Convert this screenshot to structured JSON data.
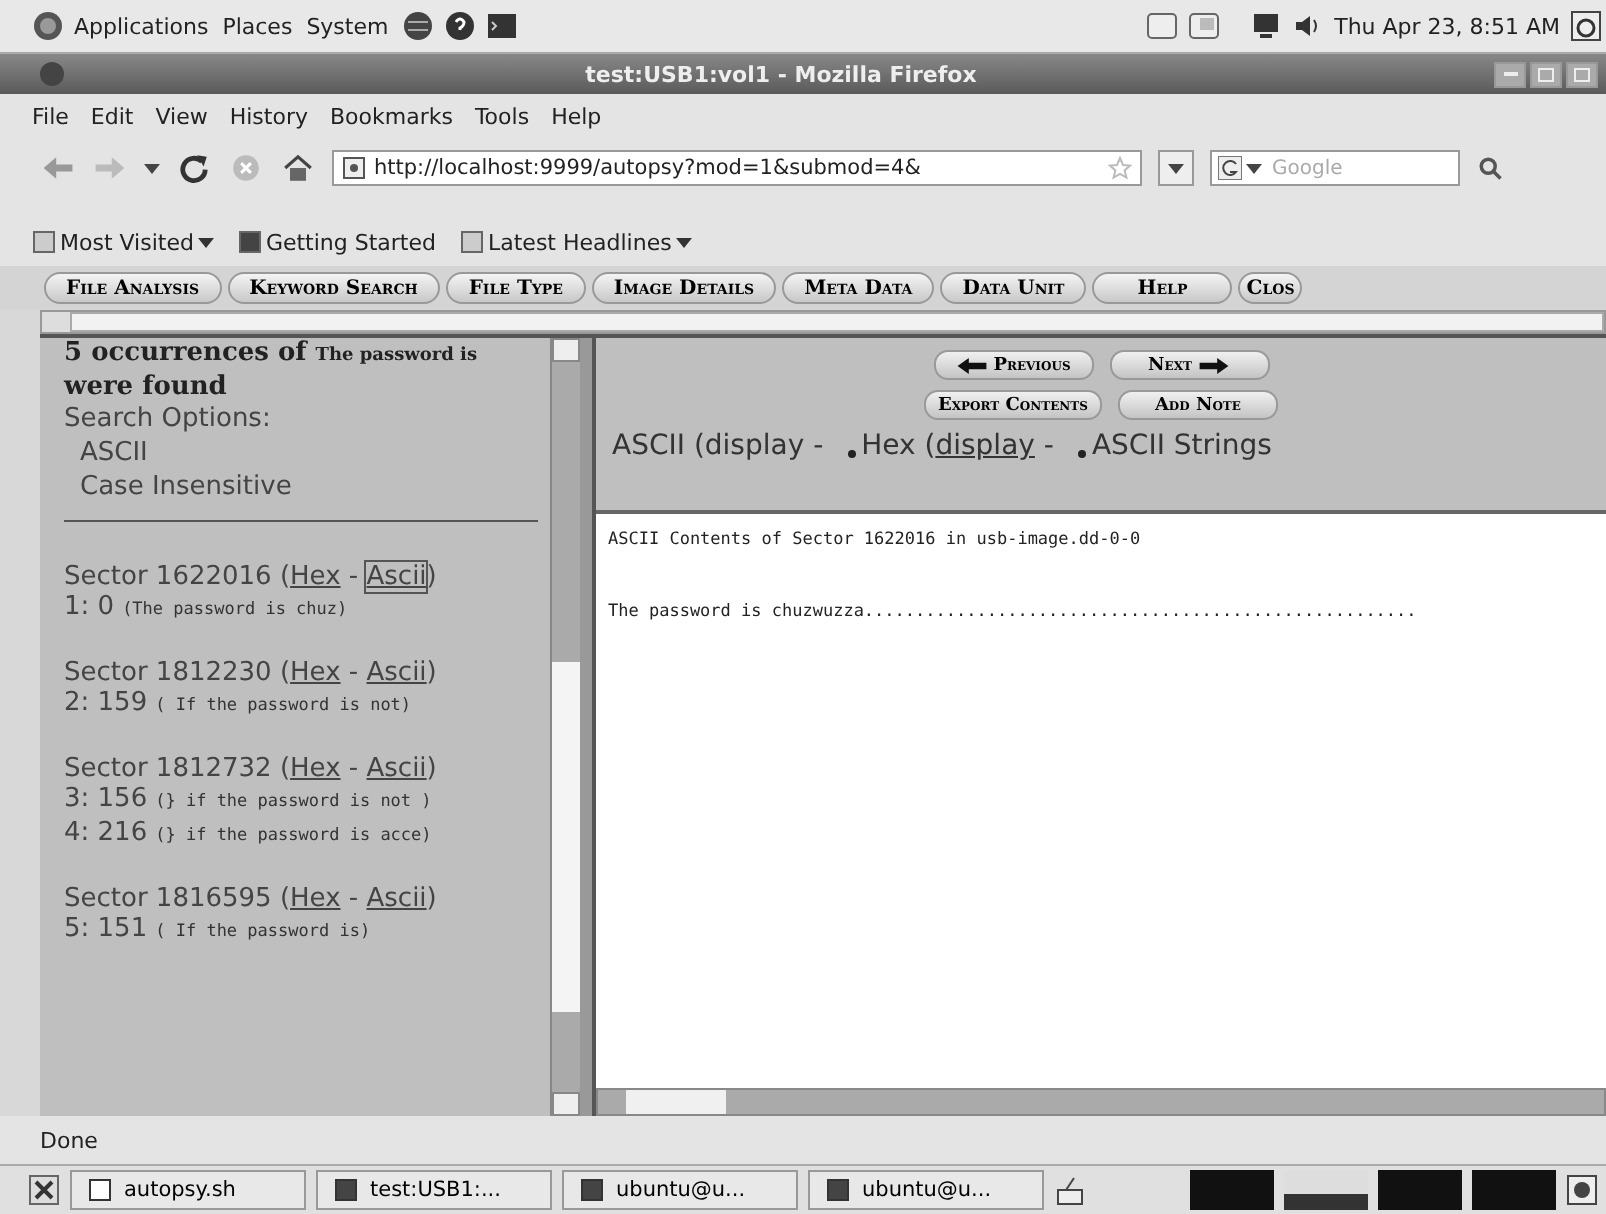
{
  "panel": {
    "menus": [
      "Applications",
      "Places",
      "System"
    ],
    "clock": "Thu Apr 23,  8:51 AM"
  },
  "window": {
    "title": "test:USB1:vol1 - Mozilla Firefox"
  },
  "menubar": [
    "File",
    "Edit",
    "View",
    "History",
    "Bookmarks",
    "Tools",
    "Help"
  ],
  "navbar": {
    "url": "http://localhost:9999/autopsy?mod=1&submod=4&",
    "search_placeholder": "Google"
  },
  "bookmarks": [
    {
      "label": "Most Visited",
      "dropdown": true
    },
    {
      "label": "Getting Started",
      "dropdown": false
    },
    {
      "label": "Latest Headlines",
      "dropdown": true
    }
  ],
  "tabs": [
    "File Analysis",
    "Keyword Search",
    "File Type",
    "Image Details",
    "Meta Data",
    "Data Unit",
    "Help",
    "Clos"
  ],
  "results": {
    "heading": "5 occurrences of",
    "keyword": "The password is",
    "heading_end": "were found",
    "options_label": "Search Options:",
    "options": [
      "ASCII",
      "Case Insensitive"
    ],
    "sectors": [
      {
        "label": "Sector 1622016 (",
        "links": [
          {
            "label": "Hex",
            "suffix": " - ",
            "selected": false
          },
          {
            "label": "Ascii",
            "suffix": ")",
            "selected": true
          }
        ],
        "hits": [
          {
            "index": "1: 0",
            "text": "(The password is chuz)"
          }
        ]
      },
      {
        "label": "Sector 1812230 (",
        "links": [
          {
            "label": "Hex",
            "suffix": " - ",
            "selected": false
          },
          {
            "label": "Ascii",
            "suffix": ")",
            "selected": false
          }
        ],
        "hits": [
          {
            "index": "2: 159",
            "text": "( If the password is not)"
          }
        ]
      },
      {
        "label": "Sector 1812732 (",
        "links": [
          {
            "label": "Hex",
            "suffix": " - ",
            "selected": false
          },
          {
            "label": "Ascii",
            "suffix": ")",
            "selected": false
          }
        ],
        "hits": [
          {
            "index": "3: 156",
            "text": "(} if the password is not )"
          },
          {
            "index": "4: 216",
            "text": "(} if the password is acce)"
          }
        ]
      },
      {
        "label": "Sector 1816595 (",
        "links": [
          {
            "label": "Hex",
            "suffix": " - ",
            "selected": false
          },
          {
            "label": "Ascii",
            "suffix": ")",
            "selected": false
          }
        ],
        "hits": [
          {
            "index": "5: 151",
            "text": "( If the password is)"
          }
        ]
      }
    ]
  },
  "viewer": {
    "buttons": [
      {
        "label": "Previous",
        "kind": "prev"
      },
      {
        "label": "Next",
        "kind": "next"
      },
      {
        "label": "Export Contents",
        "kind": "plain"
      },
      {
        "label": "Add Note",
        "kind": "plain"
      }
    ],
    "views": [
      {
        "prefix": "ASCII (display -",
        "bullet": false
      },
      {
        "prefix": "Hex (",
        "link": "display",
        "suffix": " -",
        "bullet": true
      },
      {
        "prefix": "ASCII Strings",
        "bullet": true
      }
    ],
    "content_title": "ASCII Contents of Sector 1622016 in usb-image.dd-0-0",
    "content_line": "The password is chuzwuzza......................................................"
  },
  "status_bar": "Done",
  "taskbar": {
    "items": [
      "autopsy.sh",
      "test:USB1:...",
      "ubuntu@u...",
      "ubuntu@u..."
    ],
    "workspaces": [
      {
        "selected": false
      },
      {
        "selected": true
      },
      {
        "selected": false
      },
      {
        "selected": false
      }
    ]
  }
}
